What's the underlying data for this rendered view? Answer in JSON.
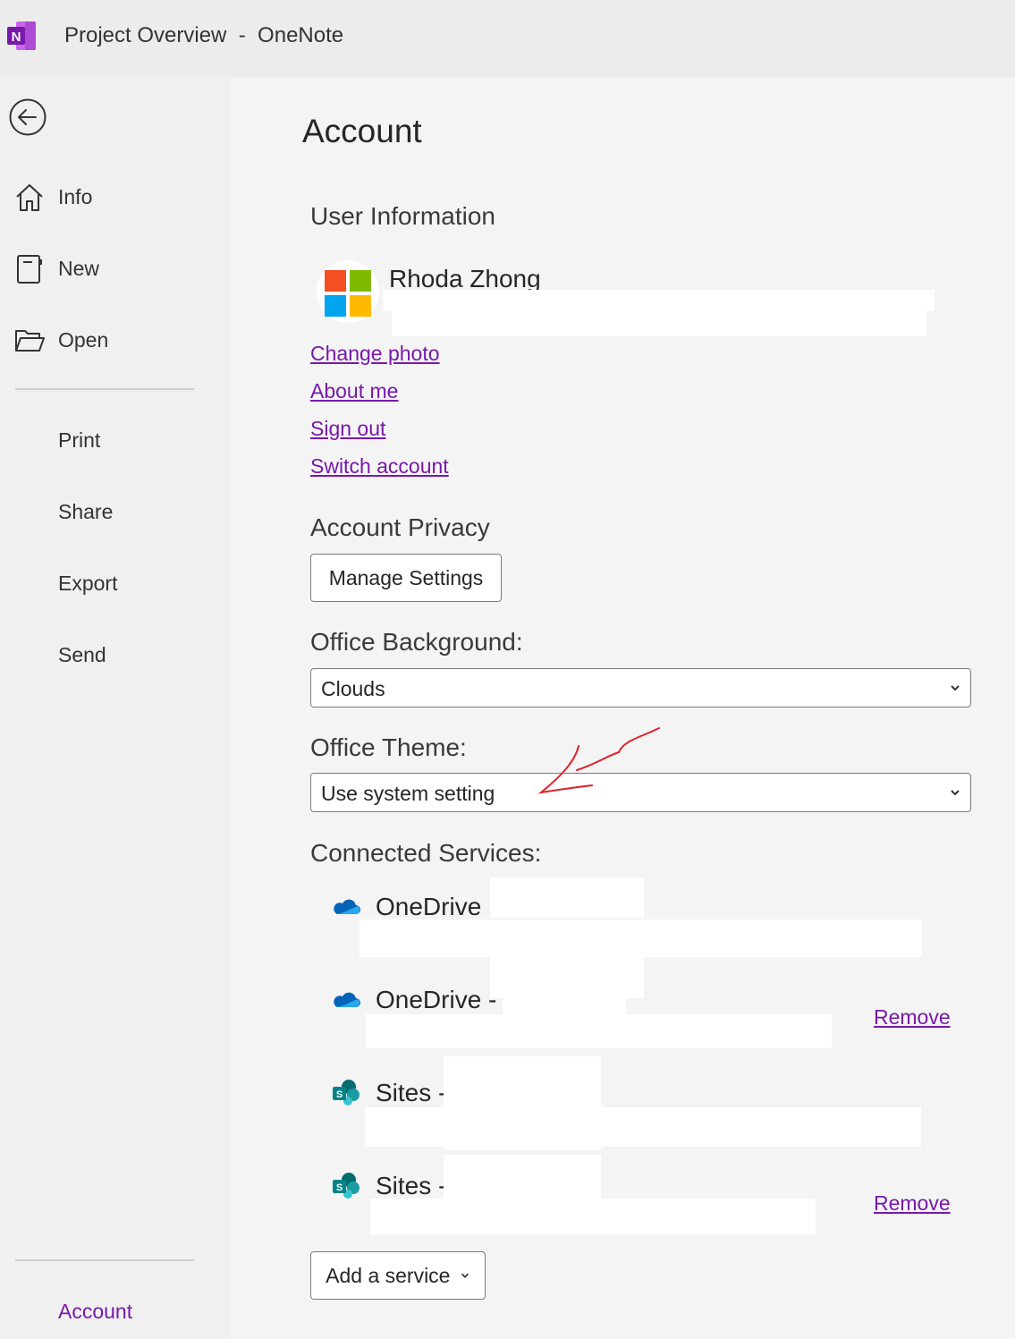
{
  "window": {
    "title": "Project Overview  -  OneNote"
  },
  "nav": {
    "items_top": [
      {
        "label": "Info",
        "icon": "home-icon"
      },
      {
        "label": "New",
        "icon": "notebook-icon"
      },
      {
        "label": "Open",
        "icon": "folder-open-icon"
      }
    ],
    "items_bottom": [
      "Print",
      "Share",
      "Export",
      "Send"
    ],
    "account": "Account"
  },
  "account": {
    "title": "Account",
    "user_info_heading": "User Information",
    "user_name": "Rhoda Zhong",
    "links": [
      "Change photo",
      "About me",
      "Sign out",
      "Switch account"
    ],
    "privacy_heading": "Account Privacy",
    "manage_settings": "Manage Settings",
    "background_heading": "Office Background:",
    "background_value": "Clouds",
    "theme_heading": "Office Theme:",
    "theme_value": "Use system setting",
    "services_heading": "Connected Services:",
    "services": [
      {
        "name": "OneDrive",
        "icon": "onedrive-icon"
      },
      {
        "name": "OneDrive -",
        "icon": "onedrive-icon",
        "remove": "Remove"
      },
      {
        "name": "Sites -",
        "icon": "sharepoint-icon"
      },
      {
        "name": "Sites -",
        "icon": "sharepoint-icon",
        "remove": "Remove"
      }
    ],
    "add_service": "Add a service",
    "annotation_color": "#e0202a"
  }
}
